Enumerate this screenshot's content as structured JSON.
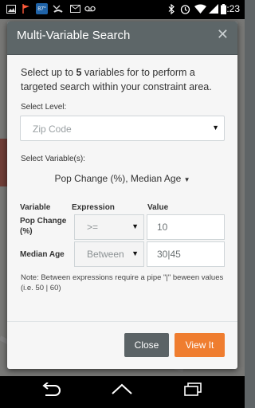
{
  "status_bar": {
    "time": "1:23",
    "notif_badge": "87°",
    "left_icons": [
      "image-icon",
      "flag-icon",
      "weather-badge-icon",
      "missed-call-icon",
      "mail-icon",
      "voicemail-icon"
    ],
    "right_icons": [
      "bluetooth-icon",
      "alarm-icon",
      "wifi-icon",
      "signal-icon",
      "battery-icon"
    ]
  },
  "modal": {
    "title": "Multi-Variable Search",
    "close_icon": "close-icon",
    "intro_prefix": "Select up to ",
    "intro_count": "5",
    "intro_suffix": " variables for to perform a targeted search within your constraint area.",
    "select_level_label": "Select Level:",
    "level_value": "Zip Code",
    "select_variables_label": "Select Variable(s):",
    "variables_value": "Pop Change (%), Median Age",
    "table": {
      "headers": [
        "Variable",
        "Expression",
        "Value"
      ],
      "rows": [
        {
          "variable": "Pop Change (%)",
          "expression": ">=",
          "value": "10"
        },
        {
          "variable": "Median Age",
          "expression": "Between",
          "value": "30|45"
        }
      ]
    },
    "note": "Note: Between expressions require a pipe \"|\" beween values (i.e. 50 | 60)",
    "buttons": {
      "close": "Close",
      "view": "View It"
    }
  },
  "nav_bar": {
    "icons": [
      "back-icon",
      "home-icon",
      "recent-apps-icon"
    ]
  },
  "colors": {
    "header": "#5d6668",
    "accent": "#ef7d2f",
    "close_button": "#5b6366"
  }
}
